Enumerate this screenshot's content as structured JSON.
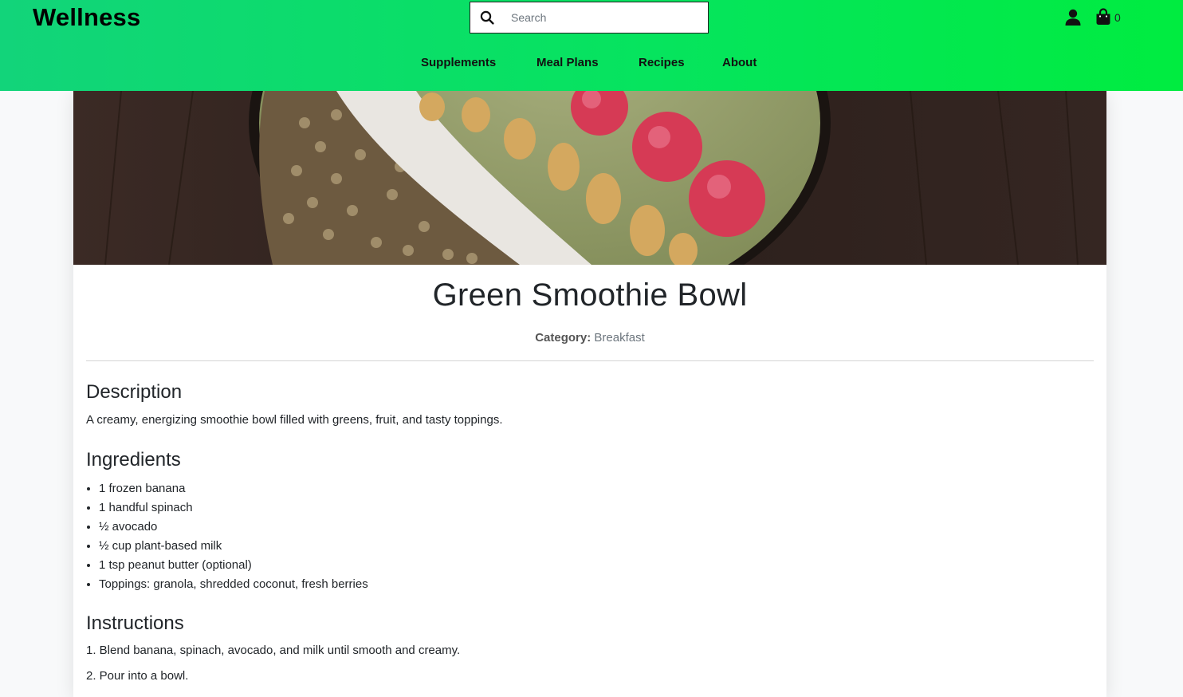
{
  "header": {
    "brand": "Wellness",
    "search_placeholder": "Search",
    "cart_count": "0",
    "icons": [
      "search-icon",
      "user-icon",
      "shopping-bag-icon"
    ],
    "gradient": [
      "#12d47a",
      "#00ec40"
    ]
  },
  "nav": {
    "items": [
      {
        "label": "Supplements"
      },
      {
        "label": "Meal Plans"
      },
      {
        "label": "Recipes"
      },
      {
        "label": "About"
      }
    ]
  },
  "recipe": {
    "title": "Green Smoothie Bowl",
    "category_label": "Category:",
    "category_value": "Breakfast",
    "description_heading": "Description",
    "description": "A creamy, energizing smoothie bowl filled with greens, fruit, and tasty toppings.",
    "ingredients_heading": "Ingredients",
    "ingredients": [
      "1 frozen banana",
      "1 handful spinach",
      "½ avocado",
      "½ cup plant-based milk",
      "1 tsp peanut butter (optional)",
      "Toppings: granola, shredded coconut, fresh berries"
    ],
    "instructions_heading": "Instructions",
    "instructions": [
      "1. Blend banana, spinach, avocado, and milk until smooth and creamy.",
      "2. Pour into a bowl."
    ]
  }
}
